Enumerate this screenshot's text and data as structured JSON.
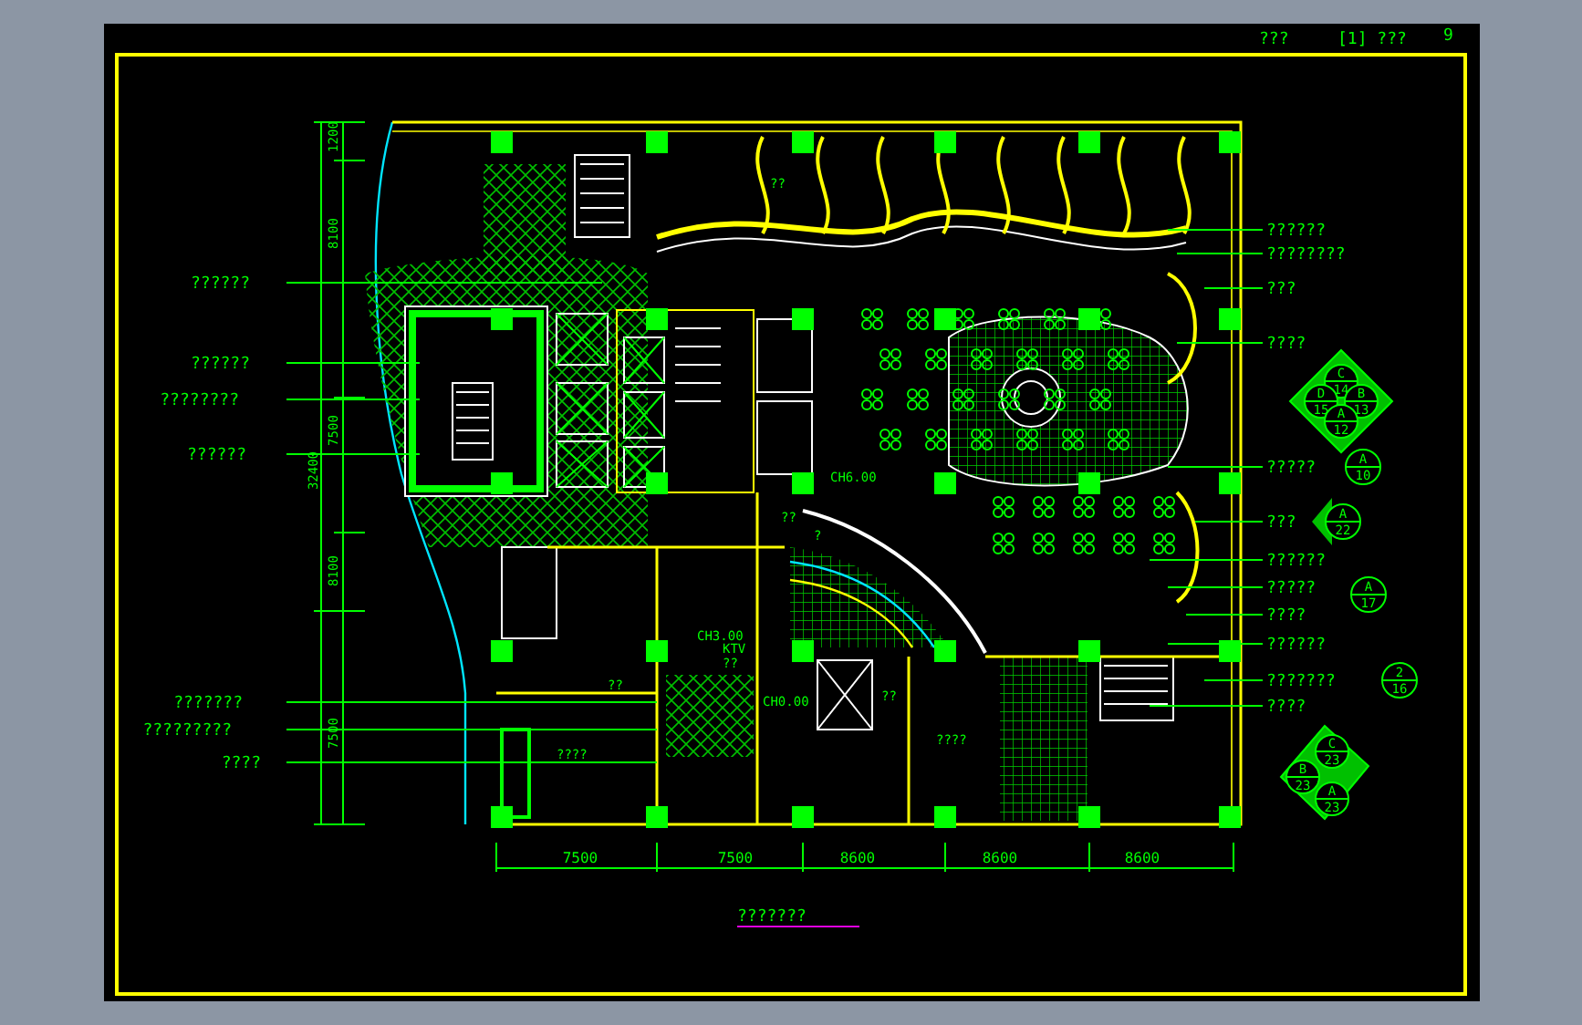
{
  "title_block": [
    "???",
    "[1] ???",
    "9"
  ],
  "left_labels": [
    "??????",
    "??????",
    "????????",
    "??????",
    "???????",
    "?????????",
    "????"
  ],
  "right_labels": [
    "??????",
    "????????",
    "???",
    "????",
    "?????",
    "???",
    "??????",
    "?????",
    "????",
    "??????",
    "???????",
    "????"
  ],
  "left_dimensions": [
    "1200",
    "8100",
    "7500",
    "32400",
    "8100",
    "7500"
  ],
  "bottom_dimensions": [
    "7500",
    "7500",
    "8600",
    "8600",
    "8600"
  ],
  "room_labels": [
    "??",
    "CH6.00",
    "??",
    "?",
    "CH3.00",
    "KTV",
    "??",
    "??",
    "CH0.00",
    "??",
    "????",
    "????"
  ],
  "section_markers": [
    {
      "kind": "diamond",
      "parts": [
        {
          "letter": "C",
          "number": "14"
        },
        {
          "letter": "D",
          "number": "15"
        },
        {
          "letter": "B",
          "number": "13"
        },
        {
          "letter": "A",
          "number": "12"
        }
      ]
    },
    {
      "kind": "circle",
      "letter": "A",
      "number": "10"
    },
    {
      "kind": "arrow",
      "letter": "A",
      "number": "22"
    },
    {
      "kind": "circle",
      "letter": "A",
      "number": "17"
    },
    {
      "kind": "circle",
      "letter": "2",
      "number": "16"
    },
    {
      "kind": "diamond3",
      "parts": [
        {
          "letter": "C",
          "number": "23"
        },
        {
          "letter": "B",
          "number": "23"
        },
        {
          "letter": "A",
          "number": "23"
        }
      ]
    }
  ],
  "drawing_title": "???????"
}
